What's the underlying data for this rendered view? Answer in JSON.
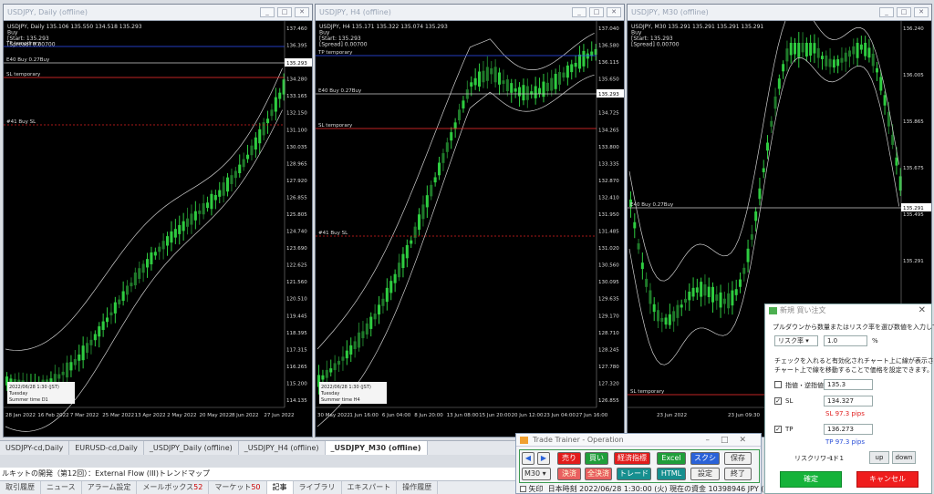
{
  "charts": [
    {
      "title": "USDJPY, Daily (offline)",
      "info": [
        "USDJPY, Daily  135.106 135.550 134.518 135.293",
        "Buy",
        "[Start: 135.293",
        "[Spread] 0.00700"
      ],
      "levels": [
        {
          "label": "TP temporary",
          "color": "#3050ff"
        },
        {
          "label": "E40 Buy 0.27Buy",
          "color": "#cccccc"
        },
        {
          "label": "SL temporary",
          "color": "#ff3030"
        },
        {
          "label": "#41 Buy SL",
          "color": "#e02020"
        }
      ],
      "prices": [
        "137.460",
        "136.395",
        "135.293",
        "134.280",
        "133.165",
        "132.150",
        "131.100",
        "130.035",
        "128.965",
        "127.920",
        "126.855",
        "125.805",
        "124.740",
        "123.690",
        "122.625",
        "121.560",
        "120.510",
        "119.445",
        "118.395",
        "117.315",
        "116.265",
        "115.200",
        "114.135"
      ],
      "price_tag": "135.293",
      "dates": [
        "28 Jan 2022",
        "16 Feb 2022",
        "7 Mar 2022",
        "25 Mar 2022",
        "13 Apr 2022",
        "2 May 2022",
        "20 May 2022",
        "8 Jun 2022",
        "27 Jun 2022"
      ],
      "stamp": [
        "2022/06/28 1:30 (JST)",
        "Tuesday",
        "Summer time   D1"
      ]
    },
    {
      "title": "USDJPY, H4 (offline)",
      "info": [
        "USDJPY, H4  135.171 135.322 135.074 135.293",
        "Buy",
        "[Start: 135.293",
        "[Spread] 0.00700"
      ],
      "levels": [
        {
          "label": "TP temporary",
          "color": "#3050ff"
        },
        {
          "label": "E40 Buy 0.27Buy",
          "color": "#cccccc"
        },
        {
          "label": "SL temporary",
          "color": "#ff3030"
        },
        {
          "label": "#41 Buy SL",
          "color": "#e02020"
        }
      ],
      "prices": [
        "137.040",
        "136.580",
        "136.115",
        "135.650",
        "135.293",
        "134.725",
        "134.265",
        "133.800",
        "133.335",
        "132.870",
        "132.410",
        "131.950",
        "131.485",
        "131.020",
        "130.560",
        "130.095",
        "129.635",
        "129.170",
        "128.710",
        "128.245",
        "127.780",
        "127.320",
        "126.855"
      ],
      "price_tag": "135.293",
      "dates": [
        "30 May 2022",
        "1 Jun 16:00",
        "6 Jun 04:00",
        "8 Jun 20:00",
        "13 Jun 08:00",
        "15 Jun 20:00",
        "20 Jun 12:00",
        "23 Jun 04:00",
        "27 Jun 16:00"
      ],
      "stamp": [
        "2022/06/28 1:30 (JST)",
        "Tuesday",
        "Summer time   H4"
      ]
    },
    {
      "title": "USDJPY, M30 (offline)",
      "info": [
        "USDJPY, M30  135.291 135.291 135.291 135.291",
        "Buy",
        "[Start: 135.293",
        "[Spread] 0.00700"
      ],
      "levels": [
        {
          "label": "E40 Buy 0.27Buy",
          "color": "#cccccc"
        },
        {
          "label": "SL temporary",
          "color": "#ff3030"
        }
      ],
      "prices": [
        "136.240",
        "136.005",
        "135.865",
        "135.675",
        "135.495",
        "135.291",
        "135.210",
        "135.025",
        "134.830"
      ],
      "price_tag": "135.291",
      "dates": [
        "23 Jun 2022",
        "23 Jun 09:30",
        "23 Jun 17:30",
        "24 Jun 01:30"
      ],
      "stamp": [
        "2022/06/28 1:30 (JST)",
        "Tuesday",
        "Summer time   M30"
      ]
    }
  ],
  "chart_tabs": [
    "USDJPY-cd,Daily",
    "EURUSD-cd,Daily",
    "_USDJPY_Daily (offline)",
    "_USDJPY_H4 (offline)",
    "_USDJPY_M30 (offline)"
  ],
  "news_line": "ルキットの開発（第12回）：External Flow (III)トレンドマップ",
  "bottom_tabs": [
    {
      "label": "取引履歴"
    },
    {
      "label": "ニュース"
    },
    {
      "label": "アラーム設定"
    },
    {
      "label": "メールボックス",
      "badge": "52"
    },
    {
      "label": "マーケット",
      "badge": "50"
    },
    {
      "label": "記事"
    },
    {
      "label": "ライブラリ"
    },
    {
      "label": "エキスパート"
    },
    {
      "label": "操作履歴"
    }
  ],
  "trade_trainer": {
    "title": "Trade Trainer - Operation",
    "timeframe": "M30",
    "buttons": {
      "sell": "売り",
      "buy": "買い",
      "indicators": "経済指標",
      "excel": "Excel",
      "screenshot": "スクショ",
      "save": "保存",
      "settle": "決済",
      "all_settle": "全決済",
      "trade": "トレード",
      "html": "HTML",
      "settings": "設定",
      "exit": "終了"
    },
    "arrow_label": "矢印",
    "status": "日本時刻 2022/06/28 1:30:00 (火)   現在の資金 10398946 JPY (3.99%)"
  },
  "order_dialog": {
    "title": "新規 買い注文",
    "instruction": "プルダウンから数量またはリスク率を選び数値を入力してください。",
    "mode": "リスク率",
    "amount": "1.0",
    "percent": "%",
    "note1": "チェックを入れると有効化されチャート上に線が表示されます。",
    "note2": "チャート上で線を移動することで価格を設定できます。",
    "limit_label": "指値・逆指値",
    "limit_value": "135.3",
    "sl_label": "SL",
    "sl_value": "134.327",
    "sl_pips": "SL 97.3 pips",
    "tp_label": "TP",
    "tp_value": "136.273",
    "tp_pips": "TP 97.3 pips",
    "rr_label": "リスクリワード",
    "rr_value": "1：1",
    "up": "up",
    "down": "down",
    "confirm": "確定",
    "cancel": "キャンセル"
  },
  "colors": {
    "bull": "#2ecc40",
    "bear": "#1f7a2a",
    "band": "#cfcfcf",
    "tp": "#3050ff",
    "sl": "#ff3030"
  }
}
